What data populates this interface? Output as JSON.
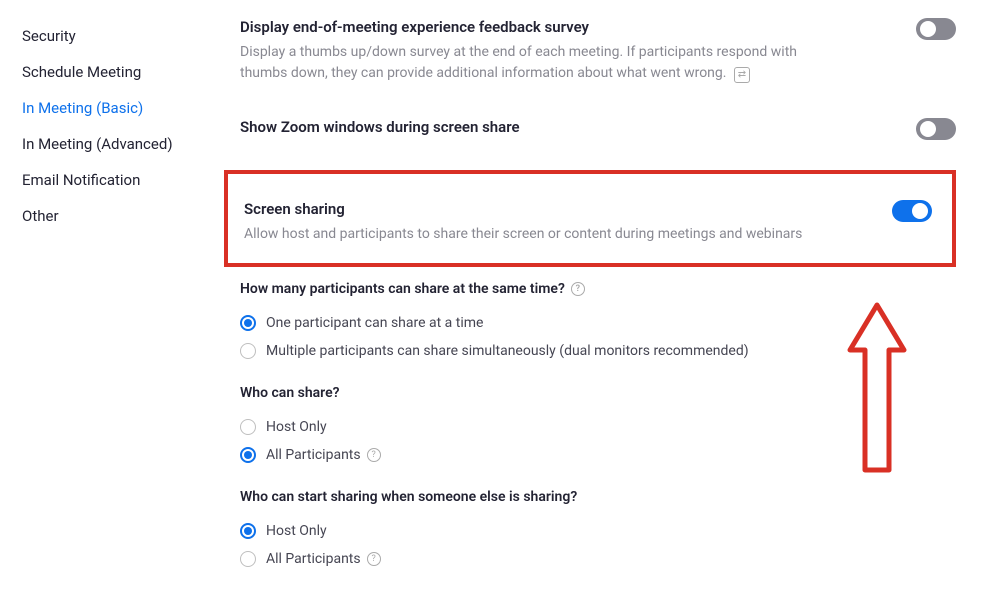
{
  "sidebar": {
    "items": [
      {
        "label": "Security",
        "active": false
      },
      {
        "label": "Schedule Meeting",
        "active": false
      },
      {
        "label": "In Meeting (Basic)",
        "active": true
      },
      {
        "label": "In Meeting (Advanced)",
        "active": false
      },
      {
        "label": "Email Notification",
        "active": false
      },
      {
        "label": "Other",
        "active": false
      }
    ]
  },
  "settings": {
    "feedback": {
      "title": "Display end-of-meeting experience feedback survey",
      "desc": "Display a thumbs up/down survey at the end of each meeting. If participants respond with thumbs down, they can provide additional information about what went wrong."
    },
    "zoom_windows": {
      "title": "Show Zoom windows during screen share"
    },
    "screen_sharing": {
      "title": "Screen sharing",
      "desc": "Allow host and participants to share their screen or content during meetings and webinars"
    },
    "q1": {
      "label": "How many participants can share at the same time?",
      "opt1": "One participant can share at a time",
      "opt2": "Multiple participants can share simultaneously (dual monitors recommended)"
    },
    "q2": {
      "label": "Who can share?",
      "opt1": "Host Only",
      "opt2": "All Participants"
    },
    "q3": {
      "label": "Who can start sharing when someone else is sharing?",
      "opt1": "Host Only",
      "opt2": "All Participants"
    }
  }
}
